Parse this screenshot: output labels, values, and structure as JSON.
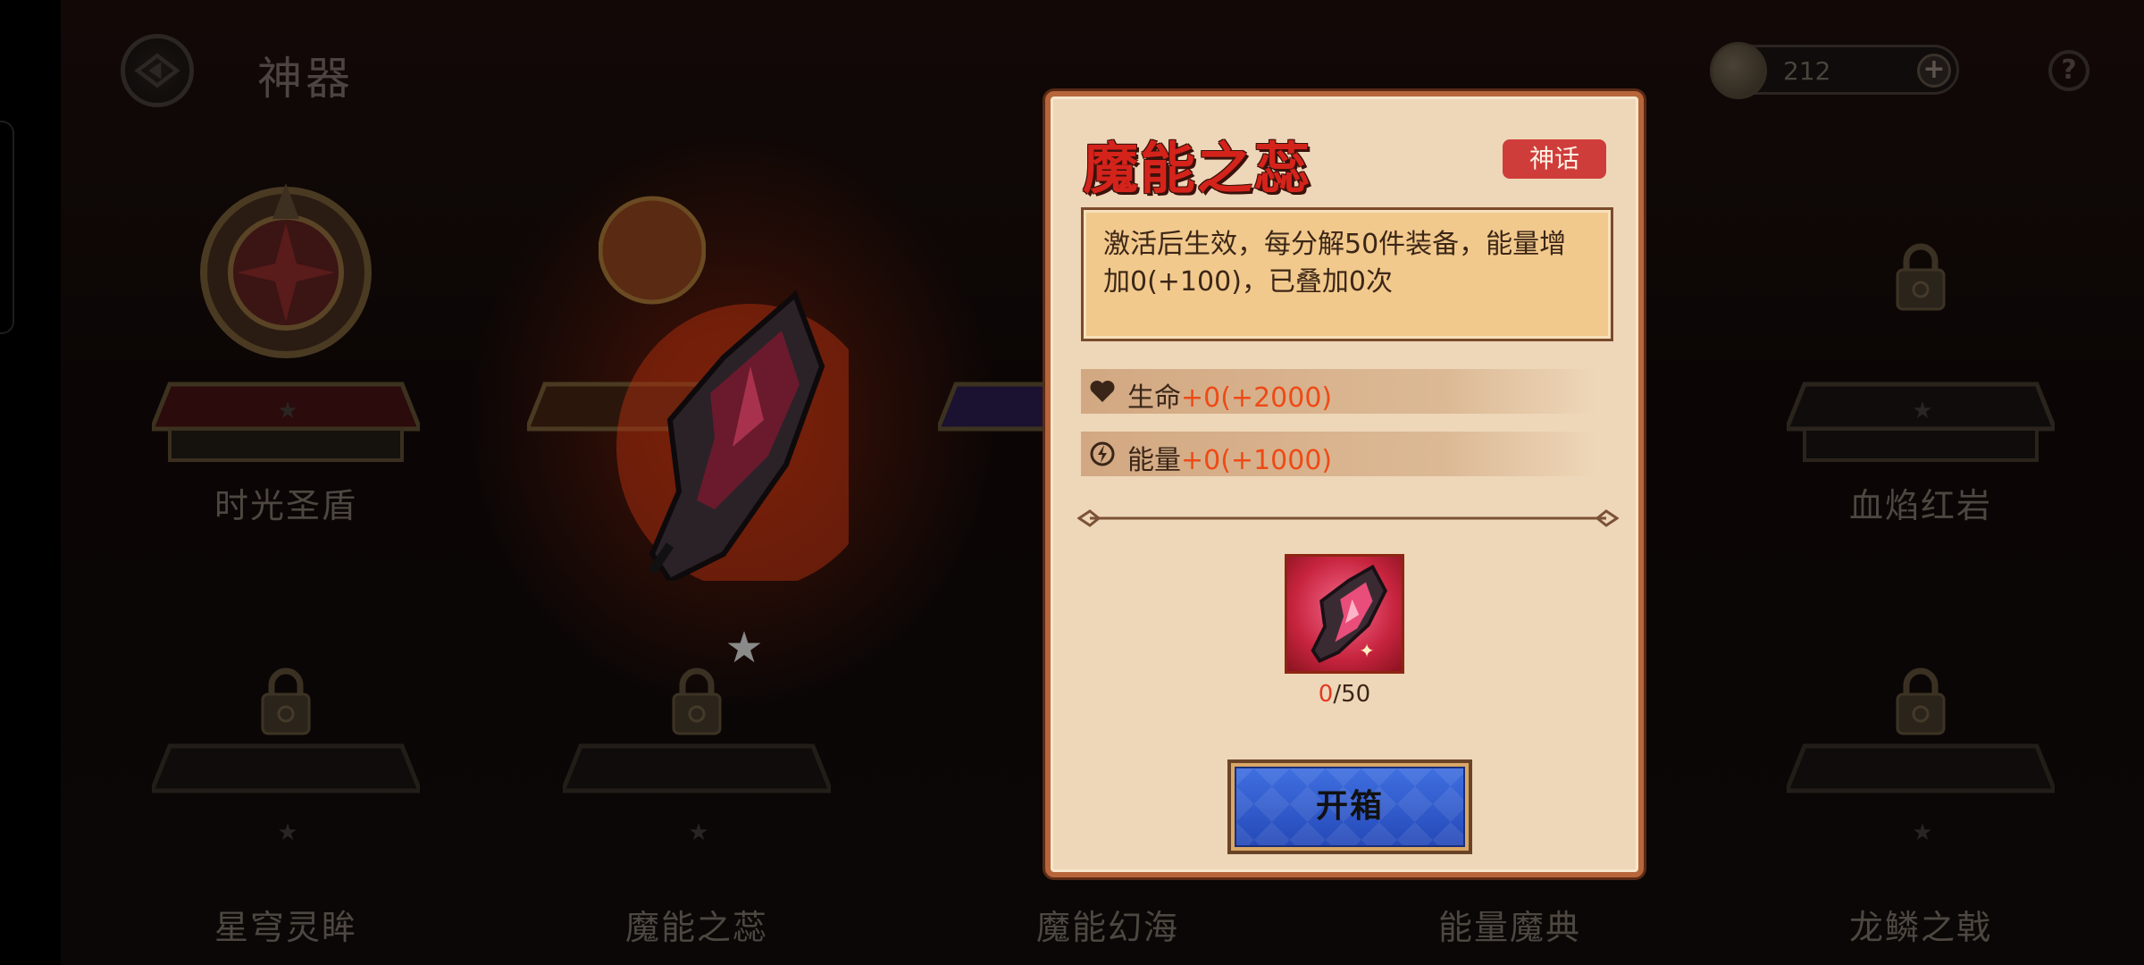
{
  "header": {
    "title": "神器",
    "currency_amount": "212",
    "plus_label": "+",
    "help_label": "?"
  },
  "artifacts": [
    {
      "name": "时光圣盾",
      "locked": false
    },
    {
      "name": "魔能之蕊",
      "locked": false
    },
    {
      "name": "",
      "locked": false
    },
    {
      "name": "",
      "locked": false
    },
    {
      "name": "血焰红岩",
      "locked": true
    },
    {
      "name": "星穹灵眸",
      "locked": true
    },
    {
      "name": "魔能之蕊",
      "locked": true
    },
    {
      "name": "魔能幻海",
      "locked": true
    },
    {
      "name": "能量魔典",
      "locked": true
    },
    {
      "name": "龙鳞之戟",
      "locked": true
    }
  ],
  "modal": {
    "title": "魔能之蕊",
    "rarity": "神话",
    "description": "激活后生效，每分解50件装备，能量增加0(+100)，已叠加0次",
    "stats": [
      {
        "icon": "heart-icon",
        "label": "生命",
        "value": "+0(+2000)"
      },
      {
        "icon": "energy-icon",
        "label": "能量",
        "value": "+0(+1000)"
      }
    ],
    "item": {
      "have": "0",
      "need": "/50"
    },
    "open_button": "开箱"
  },
  "colors": {
    "title_red": "#d4231b",
    "badge_red": "#cf3d3b",
    "stat_orange": "#ef4a16",
    "button_blue": "#2f5acd",
    "panel_beige": "#eed7b8"
  }
}
